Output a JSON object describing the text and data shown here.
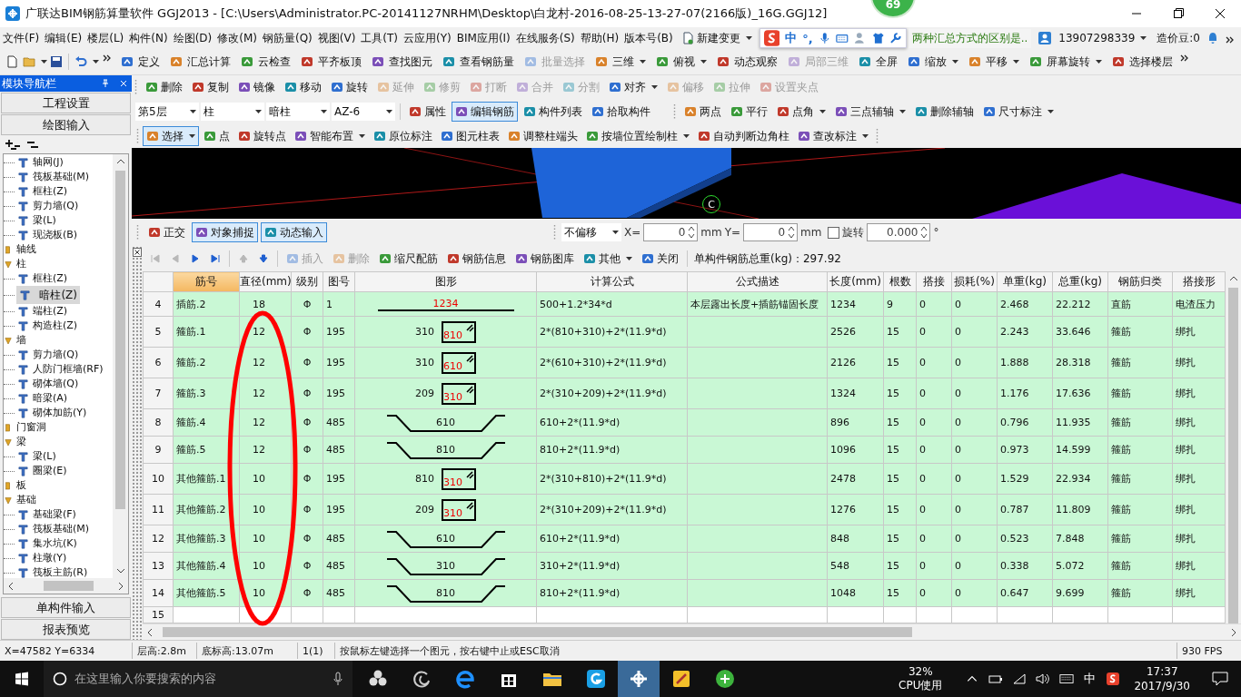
{
  "window": {
    "title": "广联达BIM钢筋算量软件 GGJ2013 - [C:\\Users\\Administrator.PC-20141127NRHM\\Desktop\\白龙村-2016-08-25-13-27-07(2166版)_16G.GGJ12]",
    "badge": "69"
  },
  "menu": [
    "文件(F)",
    "编辑(E)",
    "楼层(L)",
    "构件(N)",
    "绘图(D)",
    "修改(M)",
    "钢筋量(Q)",
    "视图(V)",
    "工具(T)",
    "云应用(Y)",
    "BIM应用(I)",
    "在线服务(S)",
    "帮助(H)",
    "版本号(B)"
  ],
  "menu_extra": {
    "new_change": "新建变更",
    "news": "两种汇总方式的区别是..",
    "user": "13907298339",
    "beans": "造价豆:0"
  },
  "ime": {
    "mode": "中",
    "punct": "°,"
  },
  "main_toolbar": [
    {
      "label": "定义",
      "kind": "button",
      "disabled": false
    },
    {
      "label": "汇总计算",
      "kind": "button",
      "disabled": false
    },
    {
      "label": "云检查",
      "kind": "button",
      "disabled": false
    },
    {
      "label": "平齐板顶",
      "kind": "button",
      "disabled": false
    },
    {
      "label": "查找图元",
      "kind": "button",
      "disabled": false
    },
    {
      "label": "查看钢筋量",
      "kind": "button",
      "disabled": false
    },
    {
      "label": "批量选择",
      "kind": "button",
      "disabled": true
    },
    {
      "label": "三维",
      "kind": "dropdown",
      "disabled": false
    },
    {
      "label": "俯视",
      "kind": "dropdown",
      "disabled": false
    },
    {
      "label": "动态观察",
      "kind": "button",
      "disabled": false
    },
    {
      "label": "局部三维",
      "kind": "button",
      "disabled": true
    },
    {
      "label": "全屏",
      "kind": "button",
      "disabled": false
    },
    {
      "label": "缩放",
      "kind": "dropdown",
      "disabled": false
    },
    {
      "label": "平移",
      "kind": "dropdown",
      "disabled": false
    },
    {
      "label": "屏幕旋转",
      "kind": "dropdown",
      "disabled": false
    },
    {
      "label": "选择楼层",
      "kind": "button",
      "disabled": false
    }
  ],
  "nav_panel": {
    "title": "模块导航栏",
    "sections": [
      "工程设置",
      "绘图输入"
    ],
    "footer": [
      "单构件输入",
      "报表预览"
    ],
    "tree": [
      {
        "kind": "item",
        "label": "轴网(J)",
        "selected": false
      },
      {
        "kind": "item",
        "label": "筏板基础(M)",
        "selected": false
      },
      {
        "kind": "item",
        "label": "框柱(Z)",
        "selected": false
      },
      {
        "kind": "item",
        "label": "剪力墙(Q)",
        "selected": false
      },
      {
        "kind": "item",
        "label": "梁(L)",
        "selected": false
      },
      {
        "kind": "item",
        "label": "现浇板(B)",
        "selected": false
      },
      {
        "kind": "folder",
        "label": "轴线",
        "expanded": false
      },
      {
        "kind": "folder",
        "label": "柱",
        "expanded": true,
        "children": [
          {
            "kind": "item",
            "label": "框柱(Z)",
            "selected": false
          },
          {
            "kind": "item",
            "label": "暗柱(Z)",
            "selected": true
          },
          {
            "kind": "item",
            "label": "端柱(Z)",
            "selected": false
          },
          {
            "kind": "item",
            "label": "构造柱(Z)",
            "selected": false
          }
        ]
      },
      {
        "kind": "folder",
        "label": "墙",
        "expanded": true,
        "children": [
          {
            "kind": "item",
            "label": "剪力墙(Q)",
            "selected": false
          },
          {
            "kind": "item",
            "label": "人防门框墙(RF)",
            "selected": false
          },
          {
            "kind": "item",
            "label": "砌体墙(Q)",
            "selected": false
          },
          {
            "kind": "item",
            "label": "暗梁(A)",
            "selected": false
          },
          {
            "kind": "item",
            "label": "砌体加筋(Y)",
            "selected": false
          }
        ]
      },
      {
        "kind": "folder",
        "label": "门窗洞",
        "expanded": false
      },
      {
        "kind": "folder",
        "label": "梁",
        "expanded": true,
        "children": [
          {
            "kind": "item",
            "label": "梁(L)",
            "selected": false
          },
          {
            "kind": "item",
            "label": "圈梁(E)",
            "selected": false
          }
        ]
      },
      {
        "kind": "folder",
        "label": "板",
        "expanded": false
      },
      {
        "kind": "folder",
        "label": "基础",
        "expanded": true,
        "children": [
          {
            "kind": "item",
            "label": "基础梁(F)",
            "selected": false
          },
          {
            "kind": "item",
            "label": "筏板基础(M)",
            "selected": false
          },
          {
            "kind": "item",
            "label": "集水坑(K)",
            "selected": false
          },
          {
            "kind": "item",
            "label": "柱墩(Y)",
            "selected": false
          },
          {
            "kind": "item",
            "label": "筏板主筋(R)",
            "selected": false
          }
        ]
      }
    ]
  },
  "edit_toolbar": [
    {
      "label": "删除",
      "kind": "button",
      "disabled": false
    },
    {
      "label": "复制",
      "kind": "button",
      "disabled": false
    },
    {
      "label": "镜像",
      "kind": "button",
      "disabled": false
    },
    {
      "label": "移动",
      "kind": "button",
      "disabled": false
    },
    {
      "label": "旋转",
      "kind": "button",
      "disabled": false
    },
    {
      "label": "延伸",
      "kind": "button",
      "disabled": true
    },
    {
      "label": "修剪",
      "kind": "button",
      "disabled": true
    },
    {
      "label": "打断",
      "kind": "button",
      "disabled": true
    },
    {
      "label": "合并",
      "kind": "button",
      "disabled": true
    },
    {
      "label": "分割",
      "kind": "button",
      "disabled": true
    },
    {
      "label": "对齐",
      "kind": "dropdown",
      "disabled": false
    },
    {
      "label": "偏移",
      "kind": "button",
      "disabled": true
    },
    {
      "label": "拉伸",
      "kind": "button",
      "disabled": true
    },
    {
      "label": "设置夹点",
      "kind": "button",
      "disabled": true
    }
  ],
  "component_toolbar": {
    "selects": [
      "第5层",
      "柱",
      "暗柱",
      "AZ-6"
    ],
    "buttons": [
      {
        "label": "属性",
        "kind": "button",
        "pressed": false
      },
      {
        "label": "编辑钢筋",
        "kind": "button",
        "pressed": true
      },
      {
        "label": "构件列表",
        "kind": "button",
        "pressed": false
      },
      {
        "label": "拾取构件",
        "kind": "button",
        "pressed": false
      },
      {
        "label": "两点",
        "kind": "button",
        "pressed": false
      },
      {
        "label": "平行",
        "kind": "button",
        "pressed": false
      },
      {
        "label": "点角",
        "kind": "dropdown",
        "pressed": false
      },
      {
        "label": "三点辅轴",
        "kind": "dropdown",
        "pressed": false
      },
      {
        "label": "删除辅轴",
        "kind": "button",
        "pressed": false
      },
      {
        "label": "尺寸标注",
        "kind": "dropdown",
        "pressed": false
      }
    ]
  },
  "draw_toolbar": [
    {
      "label": "选择",
      "kind": "dropdown",
      "pressed": true
    },
    {
      "label": "点",
      "kind": "button",
      "pressed": false
    },
    {
      "label": "旋转点",
      "kind": "button",
      "pressed": false
    },
    {
      "label": "智能布置",
      "kind": "dropdown",
      "pressed": false
    },
    {
      "label": "原位标注",
      "kind": "button",
      "pressed": false
    },
    {
      "label": "图元柱表",
      "kind": "button",
      "pressed": false
    },
    {
      "label": "调整柱端头",
      "kind": "button",
      "pressed": false
    },
    {
      "label": "按墙位置绘制柱",
      "kind": "dropdown",
      "pressed": false
    },
    {
      "label": "自动判断边角柱",
      "kind": "button",
      "pressed": false
    },
    {
      "label": "查改标注",
      "kind": "dropdown",
      "pressed": false
    }
  ],
  "viewport": {
    "marker": "C"
  },
  "snap_bar": {
    "toggles": [
      {
        "label": "正交",
        "pressed": false
      },
      {
        "label": "对象捕捉",
        "pressed": true
      },
      {
        "label": "动态输入",
        "pressed": true
      }
    ],
    "offset": "不偏移",
    "x": {
      "label": "X=",
      "value": "0",
      "unit": "mm"
    },
    "y": {
      "label": "Y=",
      "value": "0",
      "unit": "mm"
    },
    "rotate": {
      "label": "旋转",
      "checked": false,
      "value": "0.000",
      "unit": "°"
    }
  },
  "rebar_toolbar": {
    "nav": [
      {
        "kind": "first",
        "disabled": true
      },
      {
        "kind": "prev",
        "disabled": true
      },
      {
        "kind": "next",
        "disabled": false
      },
      {
        "kind": "last",
        "disabled": false
      },
      {
        "kind": "up",
        "disabled": true
      },
      {
        "kind": "down",
        "disabled": false
      }
    ],
    "buttons": [
      {
        "label": "插入",
        "kind": "button",
        "disabled": true
      },
      {
        "label": "删除",
        "kind": "button",
        "disabled": true
      },
      {
        "label": "缩尺配筋",
        "kind": "button",
        "disabled": false
      },
      {
        "label": "钢筋信息",
        "kind": "button",
        "disabled": false
      },
      {
        "label": "钢筋图库",
        "kind": "button",
        "disabled": false
      },
      {
        "label": "其他",
        "kind": "dropdown",
        "disabled": false
      },
      {
        "label": "关闭",
        "kind": "button",
        "disabled": false
      }
    ],
    "total": "单构件钢筋总重(kg)：297.92"
  },
  "table": {
    "columns": [
      {
        "label": "筋号",
        "selected": true
      },
      {
        "label": "直径(mm)",
        "selected": false
      },
      {
        "label": "级别",
        "selected": false
      },
      {
        "label": "图号",
        "selected": false
      },
      {
        "label": "图形",
        "selected": false
      },
      {
        "label": "计算公式",
        "selected": false
      },
      {
        "label": "公式描述",
        "selected": false
      },
      {
        "label": "长度(mm)",
        "selected": false
      },
      {
        "label": "根数",
        "selected": false
      },
      {
        "label": "搭接",
        "selected": false
      },
      {
        "label": "损耗(%)",
        "selected": false
      },
      {
        "label": "单重(kg)",
        "selected": false
      },
      {
        "label": "总重(kg)",
        "selected": false
      },
      {
        "label": "钢筋归类",
        "selected": false
      },
      {
        "label": "搭接形",
        "selected": false
      }
    ],
    "rows": [
      {
        "num": "4",
        "name": "插筋.2",
        "diameter": "18",
        "grade": "Φ",
        "shape_no": "1",
        "shape": {
          "kind": "line",
          "label": "1234"
        },
        "formula": "500+1.2*34*d",
        "description": "本层露出长度+插筋锚固长度",
        "length": "1234",
        "count": "9",
        "lap": "0",
        "loss": "0",
        "unit_weight": "2.468",
        "total_weight": "22.212",
        "category": "直筋",
        "lap_type": "电渣压力"
      },
      {
        "num": "5",
        "name": "箍筋.1",
        "diameter": "12",
        "grade": "Φ",
        "shape_no": "195",
        "shape": {
          "kind": "stirrup",
          "side": "310",
          "inner": "810"
        },
        "formula": "2*(810+310)+2*(11.9*d)",
        "length": "2526",
        "count": "15",
        "lap": "0",
        "loss": "0",
        "unit_weight": "2.243",
        "total_weight": "33.646",
        "category": "箍筋",
        "lap_type": "绑扎"
      },
      {
        "num": "6",
        "name": "箍筋.2",
        "diameter": "12",
        "grade": "Φ",
        "shape_no": "195",
        "shape": {
          "kind": "stirrup",
          "side": "310",
          "inner": "610"
        },
        "formula": "2*(610+310)+2*(11.9*d)",
        "length": "2126",
        "count": "15",
        "lap": "0",
        "loss": "0",
        "unit_weight": "1.888",
        "total_weight": "28.318",
        "category": "箍筋",
        "lap_type": "绑扎"
      },
      {
        "num": "7",
        "name": "箍筋.3",
        "diameter": "12",
        "grade": "Φ",
        "shape_no": "195",
        "shape": {
          "kind": "stirrup",
          "side": "209",
          "inner": "310"
        },
        "formula": "2*(310+209)+2*(11.9*d)",
        "length": "1324",
        "count": "15",
        "lap": "0",
        "loss": "0",
        "unit_weight": "1.176",
        "total_weight": "17.636",
        "category": "箍筋",
        "lap_type": "绑扎"
      },
      {
        "num": "8",
        "name": "箍筋.4",
        "diameter": "12",
        "grade": "Φ",
        "shape_no": "485",
        "shape": {
          "kind": "hook",
          "label": "610"
        },
        "formula": "610+2*(11.9*d)",
        "length": "896",
        "count": "15",
        "lap": "0",
        "loss": "0",
        "unit_weight": "0.796",
        "total_weight": "11.935",
        "category": "箍筋",
        "lap_type": "绑扎"
      },
      {
        "num": "9",
        "name": "箍筋.5",
        "diameter": "12",
        "grade": "Φ",
        "shape_no": "485",
        "shape": {
          "kind": "hook",
          "label": "810"
        },
        "formula": "810+2*(11.9*d)",
        "length": "1096",
        "count": "15",
        "lap": "0",
        "loss": "0",
        "unit_weight": "0.973",
        "total_weight": "14.599",
        "category": "箍筋",
        "lap_type": "绑扎"
      },
      {
        "num": "10",
        "name": "其他箍筋.1",
        "diameter": "10",
        "grade": "Φ",
        "shape_no": "195",
        "shape": {
          "kind": "stirrup",
          "side": "810",
          "inner": "310"
        },
        "formula": "2*(310+810)+2*(11.9*d)",
        "length": "2478",
        "count": "15",
        "lap": "0",
        "loss": "0",
        "unit_weight": "1.529",
        "total_weight": "22.934",
        "category": "箍筋",
        "lap_type": "绑扎"
      },
      {
        "num": "11",
        "name": "其他箍筋.2",
        "diameter": "10",
        "grade": "Φ",
        "shape_no": "195",
        "shape": {
          "kind": "stirrup",
          "side": "209",
          "inner": "310"
        },
        "formula": "2*(310+209)+2*(11.9*d)",
        "length": "1276",
        "count": "15",
        "lap": "0",
        "loss": "0",
        "unit_weight": "0.787",
        "total_weight": "11.809",
        "category": "箍筋",
        "lap_type": "绑扎"
      },
      {
        "num": "12",
        "name": "其他箍筋.3",
        "diameter": "10",
        "grade": "Φ",
        "shape_no": "485",
        "shape": {
          "kind": "hook",
          "label": "610"
        },
        "formula": "610+2*(11.9*d)",
        "length": "848",
        "count": "15",
        "lap": "0",
        "loss": "0",
        "unit_weight": "0.523",
        "total_weight": "7.848",
        "category": "箍筋",
        "lap_type": "绑扎"
      },
      {
        "num": "13",
        "name": "其他箍筋.4",
        "diameter": "10",
        "grade": "Φ",
        "shape_no": "485",
        "shape": {
          "kind": "hook",
          "label": "310"
        },
        "formula": "310+2*(11.9*d)",
        "length": "548",
        "count": "15",
        "lap": "0",
        "loss": "0",
        "unit_weight": "0.338",
        "total_weight": "5.072",
        "category": "箍筋",
        "lap_type": "绑扎"
      },
      {
        "num": "14",
        "name": "其他箍筋.5",
        "diameter": "10",
        "grade": "Φ",
        "shape_no": "485",
        "shape": {
          "kind": "hook",
          "label": "810"
        },
        "formula": "810+2*(11.9*d)",
        "length": "1048",
        "count": "15",
        "lap": "0",
        "loss": "0",
        "unit_weight": "0.647",
        "total_weight": "9.699",
        "category": "箍筋",
        "lap_type": "绑扎"
      },
      {
        "num": "15"
      }
    ]
  },
  "status_bar": [
    "X=47582 Y=6334",
    "层高:2.8m",
    "底标高:13.07m",
    "1(1)",
    "按鼠标左键选择一个图元，按右键中止或ESC取消",
    "930 FPS"
  ],
  "taskbar": {
    "search_placeholder": "在这里输入你要搜索的内容",
    "cpu": "32%",
    "cpu_label": "CPU使用",
    "ime": "中",
    "time": "17:37",
    "date": "2017/9/30"
  }
}
